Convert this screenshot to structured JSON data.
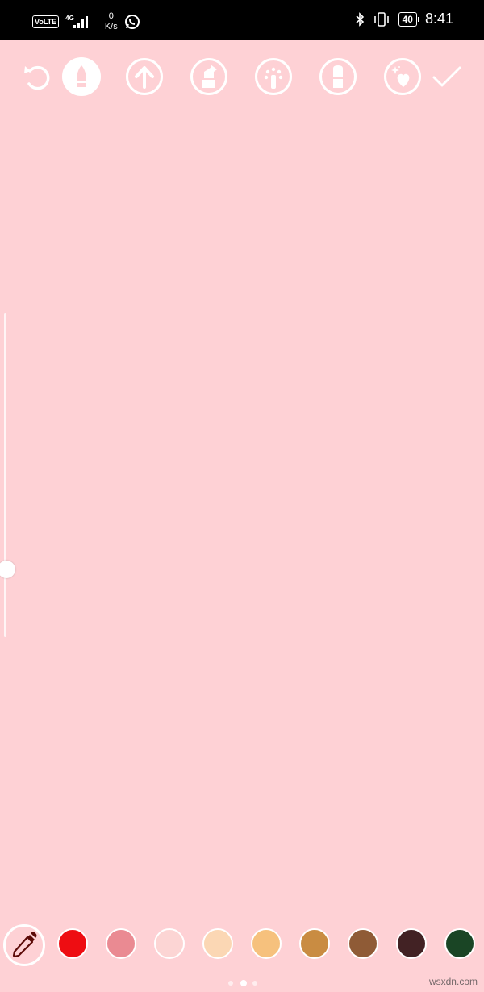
{
  "status_bar": {
    "volte": "VoLTE",
    "network": "4G",
    "speed_value": "0",
    "speed_unit": "K/s",
    "battery": "40",
    "time": "8:41",
    "icons": [
      "signal-bars-icon",
      "whatsapp-icon",
      "bluetooth-icon",
      "vibrate-icon",
      "battery-icon"
    ]
  },
  "toolbar": {
    "tools": [
      {
        "name": "undo",
        "icon": "undo-icon"
      },
      {
        "name": "pen",
        "icon": "pen-icon",
        "active": true
      },
      {
        "name": "arrow",
        "icon": "arrow-up-icon"
      },
      {
        "name": "marker",
        "icon": "marker-icon"
      },
      {
        "name": "neon",
        "icon": "neon-icon"
      },
      {
        "name": "eraser",
        "icon": "eraser-icon"
      },
      {
        "name": "special",
        "icon": "sparkle-heart-icon"
      },
      {
        "name": "done",
        "icon": "checkmark-icon"
      }
    ]
  },
  "brush_size": {
    "level": 0.21
  },
  "palette": {
    "eyedropper": "eyedropper-icon",
    "colors": [
      "#ee0d12",
      "#ea8a92",
      "#fcd5d4",
      "#fbd7b4",
      "#f6c17d",
      "#c98c42",
      "#8f5b36",
      "#422224",
      "#1a4525"
    ],
    "selected_color": "#fcd5d4"
  },
  "pager": {
    "count": 3,
    "active": 2
  },
  "watermark": "wsxdn.com",
  "colors": {
    "canvas": "#fed1d5",
    "status_bar": "#000000",
    "icon": "#ffffff"
  }
}
